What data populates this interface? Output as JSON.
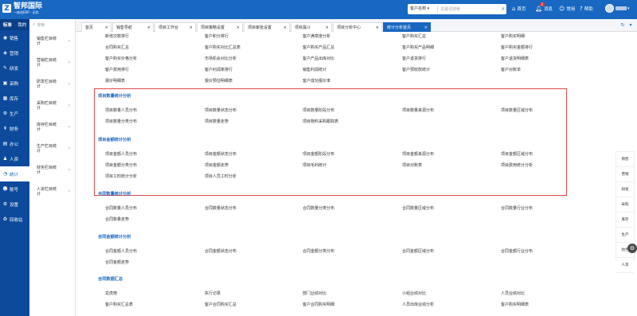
{
  "app": {
    "name": "智邦国际",
    "tagline": "一体化ERP · 无忧"
  },
  "search": {
    "scope": "客户名称",
    "placeholder": "关键词搜索"
  },
  "topnav": [
    {
      "label": "首页",
      "icon": "home-icon"
    },
    {
      "label": "消息",
      "icon": "bell-icon",
      "badge": "2"
    },
    {
      "label": "常用",
      "icon": "user-icon"
    },
    {
      "label": "帮助",
      "icon": "help-icon"
    }
  ],
  "sidebar1": {
    "header": [
      "标准",
      "我的"
    ],
    "items": [
      {
        "label": "销售",
        "icon": "sales-icon"
      },
      {
        "label": "营销",
        "icon": "marketing-icon"
      },
      {
        "label": "研发",
        "icon": "rnd-icon"
      },
      {
        "label": "采购",
        "icon": "purchase-icon"
      },
      {
        "label": "库存",
        "icon": "inventory-icon"
      },
      {
        "label": "生产",
        "icon": "production-icon"
      },
      {
        "label": "财务",
        "icon": "finance-icon"
      },
      {
        "label": "办公",
        "icon": "office-icon"
      },
      {
        "label": "人资",
        "icon": "hr-icon"
      },
      {
        "label": "统计",
        "icon": "stats-icon"
      },
      {
        "label": "账号",
        "icon": "account-icon"
      },
      {
        "label": "设置",
        "icon": "settings-icon"
      },
      {
        "label": "回收站",
        "icon": "recycle-icon"
      }
    ]
  },
  "sidebar2": {
    "search_placeholder": "搜索",
    "items": [
      "销售栏目统计",
      "营销栏目统计",
      "研发栏目统计",
      "采购栏目统计",
      "库存栏目统计",
      "生产栏目统计",
      "财务栏目统计",
      "人资栏目统计"
    ]
  },
  "tabs": [
    "首页",
    "销售导航",
    "项目工作台",
    "项目策略设置",
    "项目审批设置",
    "项目漏斗",
    "项目分析中心",
    "统计分析首页"
  ],
  "top_items": [
    [
      "新增次数排行",
      "客户积分排行",
      "客户满意度分析",
      "客户购买汇总",
      "客户购买明细"
    ],
    [
      "合同购买汇总",
      "客户购买对比汇总表",
      "客户购买产品汇总",
      "客户购买产品明细",
      "客户购买金额排行"
    ],
    [
      "客户购买价格分析",
      "市场机会对比分析",
      "客户产品出库对比",
      "客户退货排行",
      "客户退货明细表"
    ],
    [
      "客户费用排行",
      "客户利润率排行",
      "销售利润统计",
      "客户预收款统计",
      "客户对账单"
    ],
    [
      "报价明细表",
      "报价预估明细表",
      "客户成功报价率"
    ]
  ],
  "sections": [
    {
      "title": "项目数量统计分析",
      "rows": [
        [
          "项目数量人员分布",
          "项目数量状态分布",
          "项目数量阶段分布",
          "项目数量来源分布",
          "项目数量区域分布"
        ],
        [
          "项目数量分类分布",
          "项目数量走势",
          "项目物料采购跟踪表"
        ]
      ]
    },
    {
      "title": "项目金额统计分析",
      "rows": [
        [
          "项目金额人员分布",
          "项目金额状态分布",
          "项目金额阶段分布",
          "项目金额来源分布",
          "项目金额区域分布"
        ],
        [
          "项目金额分类分布",
          "项目金额走势",
          "项目毛利统计",
          "项目对账表",
          "项目费用统计分析"
        ],
        [
          "项目工时统计分析",
          "项目人员工时分析"
        ]
      ]
    },
    {
      "title": "合同数量统计分析",
      "rows": [
        [
          "合同数量人员分布",
          "合同数量状态分布",
          "合同数量分类分布",
          "合同数量区域分布",
          "合同数量行业分布"
        ],
        [
          "合同数量走势"
        ]
      ]
    },
    {
      "title": "合同金额统计分析",
      "rows": [
        [
          "合同金额人员分布",
          "合同金额状态分布",
          "合同金额分类分布",
          "合同金额区域分布",
          "合同金额行业分布"
        ],
        [
          "合同金额走势"
        ]
      ]
    },
    {
      "title": "合同数据汇总",
      "rows": [
        [
          "龙虎榜",
          "执行记录",
          "部门业绩对比",
          "小组业绩对比",
          "人员业绩对比"
        ],
        [
          "客户购买汇总表",
          "客户合同购买汇总",
          "客户合同购买明细",
          "人员出库业绩分析",
          "客户购买明细表"
        ]
      ]
    }
  ],
  "rightnav": [
    "销售",
    "营销",
    "研发",
    "采购",
    "库存",
    "生产",
    "财务",
    "人资"
  ],
  "colors": {
    "primary": "#1867c0",
    "sidebar": "#0d4a9c",
    "highlight_border": "#e44848"
  }
}
